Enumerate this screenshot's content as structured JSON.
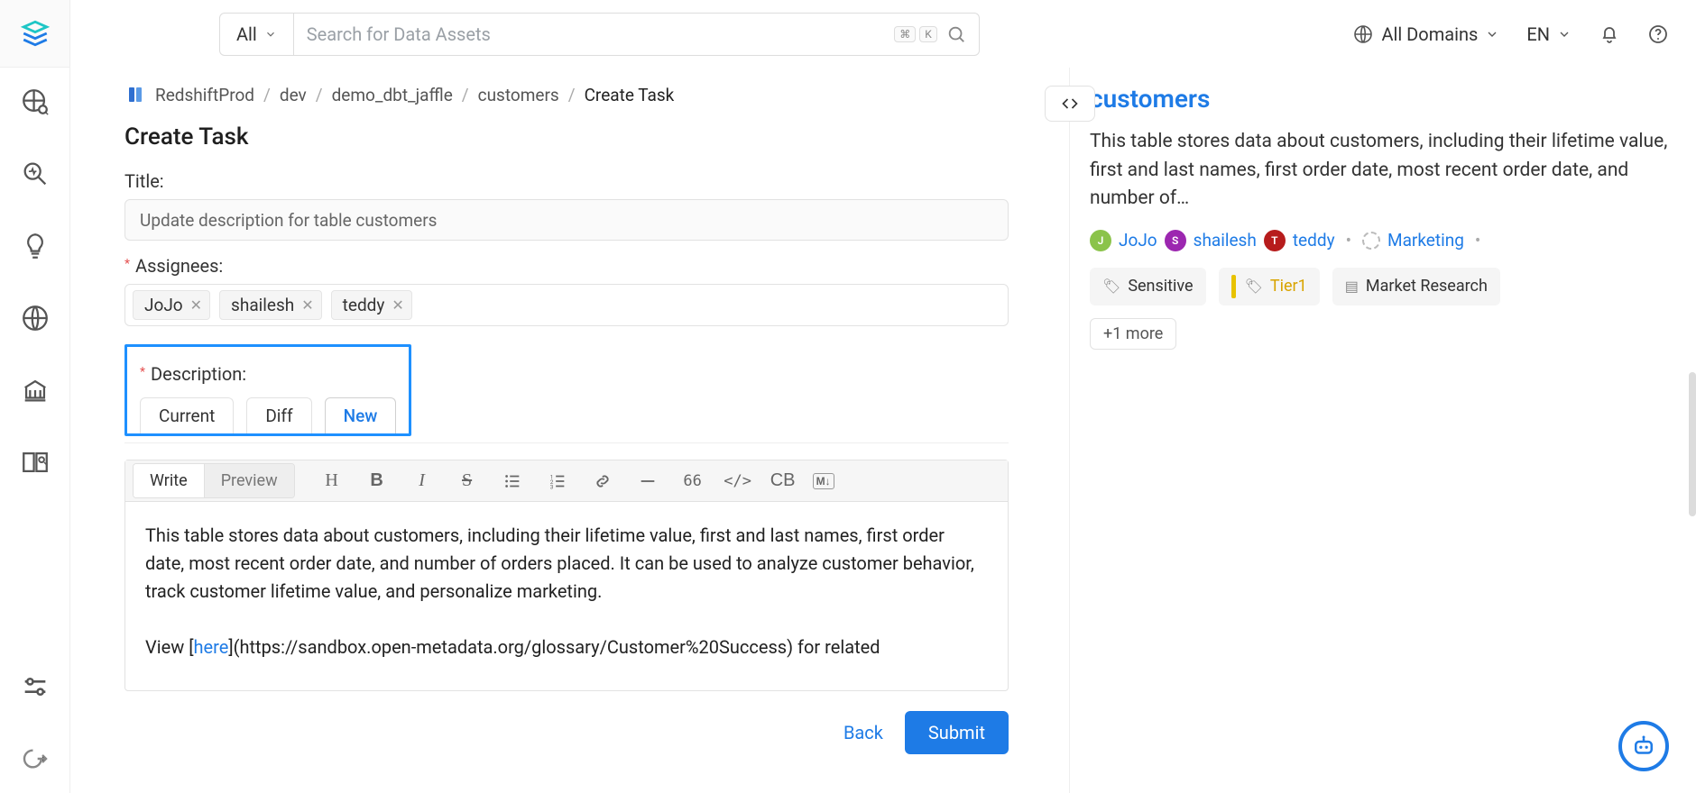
{
  "header": {
    "filter_label": "All",
    "search_placeholder": "Search for Data Assets",
    "kbd1": "⌘",
    "kbd2": "K",
    "domains_label": "All Domains",
    "lang_label": "EN"
  },
  "breadcrumb": {
    "items": [
      "RedshiftProd",
      "dev",
      "demo_dbt_jaffle",
      "customers",
      "Create Task"
    ]
  },
  "page": {
    "title": "Create Task",
    "title_field_label": "Title:",
    "title_field_value": "Update description for table customers",
    "assignees_label": "Assignees:",
    "assignees": [
      "JoJo",
      "shailesh",
      "teddy"
    ],
    "description_label": "Description:",
    "desc_tabs": {
      "current": "Current",
      "diff": "Diff",
      "new": "New"
    },
    "editor_tabs": {
      "write": "Write",
      "preview": "Preview"
    },
    "toolbar": {
      "quote": "66",
      "cb": "CB",
      "md": "M↓"
    },
    "editor_text_1": "This table stores data about customers, including their lifetime value, first and last names, first order date, most recent order date, and number of orders placed. It can be used to analyze customer behavior, track customer lifetime value, and personalize marketing.",
    "editor_text_2a": "View [",
    "editor_link": "here",
    "editor_text_2b": "](https://sandbox.open-metadata.org/glossary/Customer%20Success) for related",
    "back_label": "Back",
    "submit_label": "Submit"
  },
  "right": {
    "title": "customers",
    "description": "This table stores data about customers, including their lifetime value, first and last names, first order date, most recent order date, and number of…",
    "owners": [
      {
        "initial": "J",
        "name": "JoJo",
        "color": "#8BC34A"
      },
      {
        "initial": "S",
        "name": "shailesh",
        "color": "#9C27B0"
      },
      {
        "initial": "T",
        "name": "teddy",
        "color": "#B71C1C"
      }
    ],
    "domain": "Marketing",
    "tags": {
      "sensitive": "Sensitive",
      "tier": "Tier1",
      "research": "Market Research",
      "more": "+1 more"
    }
  }
}
